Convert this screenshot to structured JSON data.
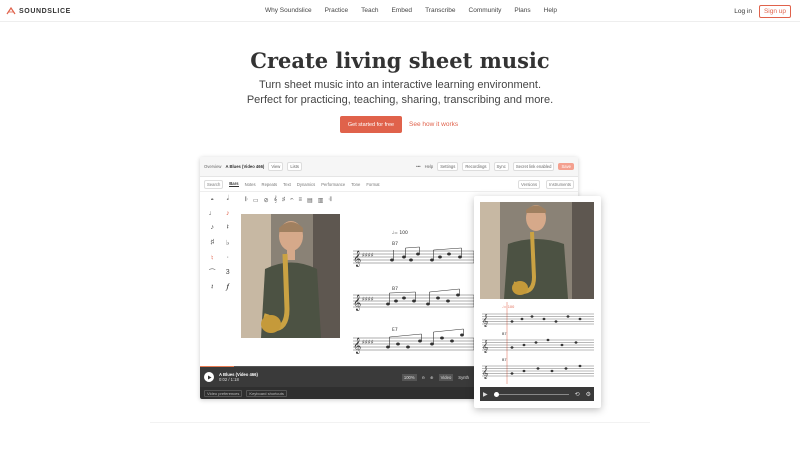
{
  "brand": {
    "name": "SOUNDSLICE",
    "accent": "#e0624b"
  },
  "nav": {
    "links": [
      "Why Soundslice",
      "Practice",
      "Teach",
      "Embed",
      "Transcribe",
      "Community",
      "Plans",
      "Help"
    ],
    "login": "Log in",
    "signup": "Sign up"
  },
  "hero": {
    "title": "Create living sheet music",
    "subtitle_line1": "Turn sheet music into an interactive learning environment.",
    "subtitle_line2": "Perfect for practicing, teaching, sharing, transcribing and more.",
    "cta_primary": "Get started for free",
    "cta_secondary": "See how it works"
  },
  "app": {
    "overview": "Overview",
    "title": "A Blues (Video 466)",
    "view": "View",
    "lists": "Lists",
    "help": "Help",
    "settings": "Settings",
    "recordings": "Recordings",
    "sync": "Sync",
    "secret": "Secret link enabled",
    "save": "Save",
    "search": "Search",
    "tabs": [
      "Bars",
      "Notes",
      "Repeats",
      "Text",
      "Dynamics",
      "Performance",
      "Tone",
      "Format"
    ],
    "versions": "Versions",
    "instruments": "Instruments",
    "score_tempo": "♩= 100",
    "chords": [
      "B7",
      "B7",
      "E7"
    ],
    "player_title": "A Blues (Video 466)",
    "player_time": "0:02 / 1:18",
    "zoom": "100%",
    "video_toggle": "Video",
    "synth": "Synth",
    "video_prefs": "Video preferences",
    "keyboard_shortcuts": "Keyboard shortcuts",
    "progress": 0.09
  },
  "mobile": {
    "tempo": "♩= 100",
    "chords": [
      "B7",
      "B7"
    ]
  }
}
